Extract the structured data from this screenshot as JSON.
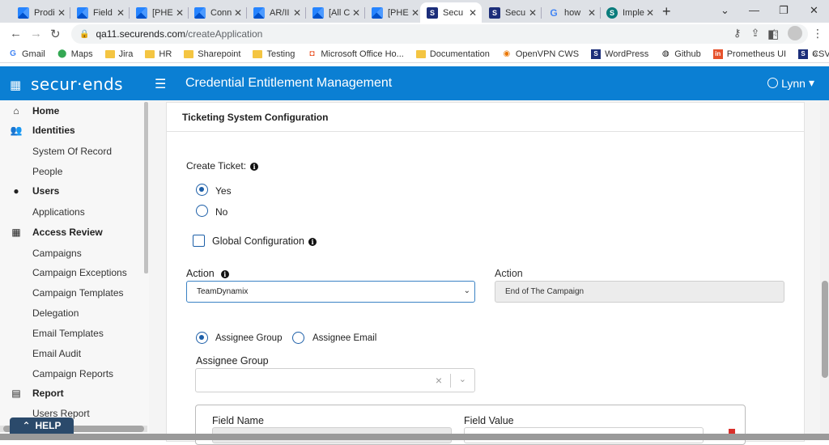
{
  "browser": {
    "tabs": [
      {
        "label": "Prodi",
        "icon": "jira-icon",
        "active": false
      },
      {
        "label": "Field",
        "icon": "jira-icon",
        "active": false
      },
      {
        "label": "[PHE",
        "icon": "jira-icon",
        "active": false
      },
      {
        "label": "Conn",
        "icon": "jira-icon",
        "active": false
      },
      {
        "label": "AR/II",
        "icon": "jira-icon",
        "active": false
      },
      {
        "label": "[All C",
        "icon": "jira-icon",
        "active": false
      },
      {
        "label": "[PHE",
        "icon": "jira-icon",
        "active": false
      },
      {
        "label": "Secu",
        "icon": "securends-icon",
        "active": true
      },
      {
        "label": "Secu",
        "icon": "securends-icon",
        "active": false
      },
      {
        "label": "how",
        "icon": "google-icon",
        "active": false
      },
      {
        "label": "Imple",
        "icon": "sharepoint-icon",
        "active": false
      }
    ],
    "url_host": "qa11.securends.com",
    "url_path": "/createApplication",
    "bookmarks": [
      {
        "label": "Gmail",
        "icon": "gmail-icon"
      },
      {
        "label": "Maps",
        "icon": "maps-icon"
      },
      {
        "label": "Jira",
        "icon": "folder-icon"
      },
      {
        "label": "HR",
        "icon": "folder-icon"
      },
      {
        "label": "Sharepoint",
        "icon": "folder-icon"
      },
      {
        "label": "Testing",
        "icon": "folder-icon"
      },
      {
        "label": "Microsoft Office Ho...",
        "icon": "office-icon"
      },
      {
        "label": "Documentation",
        "icon": "folder-icon"
      },
      {
        "label": "OpenVPN CWS",
        "icon": "openvpn-icon"
      },
      {
        "label": "WordPress",
        "icon": "securends-icon"
      },
      {
        "label": "Github",
        "icon": "github-icon"
      },
      {
        "label": "Prometheus UI",
        "icon": "prometheus-icon"
      },
      {
        "label": "CSV Utility",
        "icon": "securends-icon"
      }
    ],
    "bookmarks_more": "»"
  },
  "app": {
    "logo": "secur·ends",
    "title": "Credential Entitlement Management",
    "user": "Lynn"
  },
  "sidebar": {
    "items": [
      {
        "label": "Home",
        "type": "head",
        "icon": "home-icon",
        "glyph": "⌂"
      },
      {
        "label": "Identities",
        "type": "head",
        "icon": "identities-icon",
        "glyph": "👥"
      },
      {
        "label": "System Of Record",
        "type": "sub"
      },
      {
        "label": "People",
        "type": "sub"
      },
      {
        "label": "Users",
        "type": "head",
        "icon": "user-icon",
        "glyph": "●"
      },
      {
        "label": "Applications",
        "type": "sub"
      },
      {
        "label": "Access Review",
        "type": "head",
        "icon": "grid-icon",
        "glyph": "▦"
      },
      {
        "label": "Campaigns",
        "type": "sub"
      },
      {
        "label": "Campaign Exceptions",
        "type": "sub"
      },
      {
        "label": "Campaign Templates",
        "type": "sub"
      },
      {
        "label": "Delegation",
        "type": "sub"
      },
      {
        "label": "Email Templates",
        "type": "sub"
      },
      {
        "label": "Email Audit",
        "type": "sub"
      },
      {
        "label": "Campaign Reports",
        "type": "sub"
      },
      {
        "label": "Report",
        "type": "head",
        "icon": "report-icon",
        "glyph": "▤"
      },
      {
        "label": "Users Report",
        "type": "sub"
      }
    ],
    "help": "HELP"
  },
  "form": {
    "section_title": "Ticketing System Configuration",
    "create_ticket_label": "Create Ticket:",
    "create_ticket_options": [
      {
        "label": "Yes",
        "checked": true
      },
      {
        "label": "No",
        "checked": false
      }
    ],
    "global_config_label": "Global Configuration",
    "global_config_checked": false,
    "action_label": "Action",
    "action_value": "TeamDynamix",
    "action2_label": "Action",
    "action2_value": "End of The Campaign",
    "assignee_options": [
      {
        "label": "Assignee Group",
        "checked": true
      },
      {
        "label": "Assignee Email",
        "checked": false
      }
    ],
    "assignee_group_label": "Assignee Group",
    "assignee_group_value": "",
    "table_headers": [
      "Field Name",
      "Field Value"
    ]
  }
}
